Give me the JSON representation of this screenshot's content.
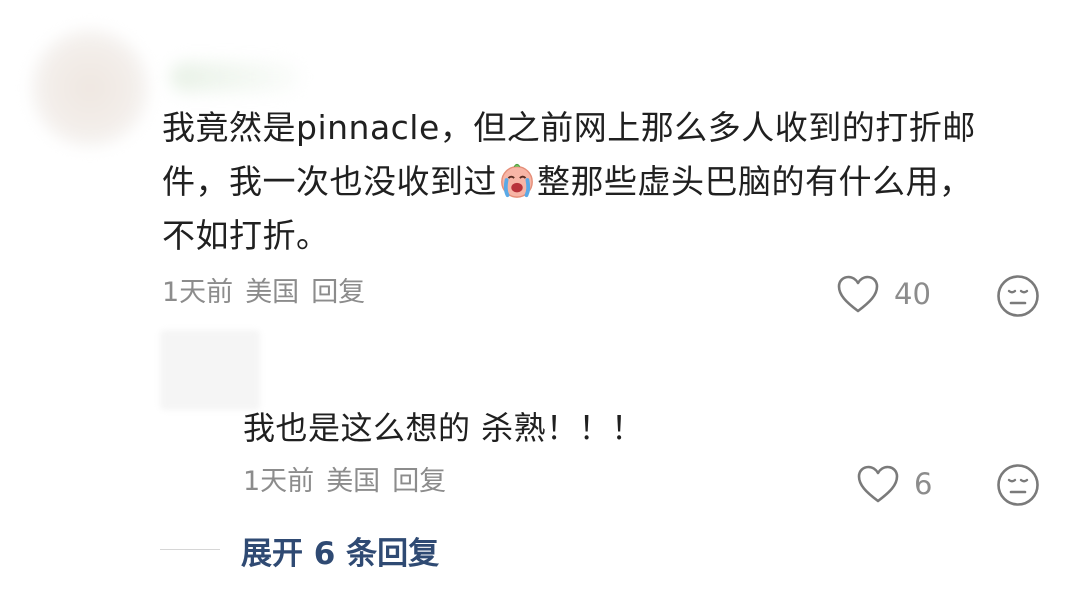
{
  "comment_main": {
    "text_lines": [
      "我竟然是pinnacle，但之前网上那么多人收到的打折邮",
      "件，我一次也没收到过",
      "整那些虚头巴脑的有什么用，",
      "不如打折。"
    ],
    "emoji": "crying-face-emoji",
    "time": "1天前",
    "location": "美国",
    "reply_label": "回复",
    "like_count": "40"
  },
  "reply_comment": {
    "text": "我也是这么想的 杀熟！！！",
    "time": "1天前",
    "location": "美国",
    "reply_label": "回复",
    "like_count": "6"
  },
  "expand_replies": {
    "label": "展开 6 条回复"
  },
  "colors": {
    "text": "#202020",
    "meta": "#8c8c8c",
    "link": "#2f4a73"
  }
}
